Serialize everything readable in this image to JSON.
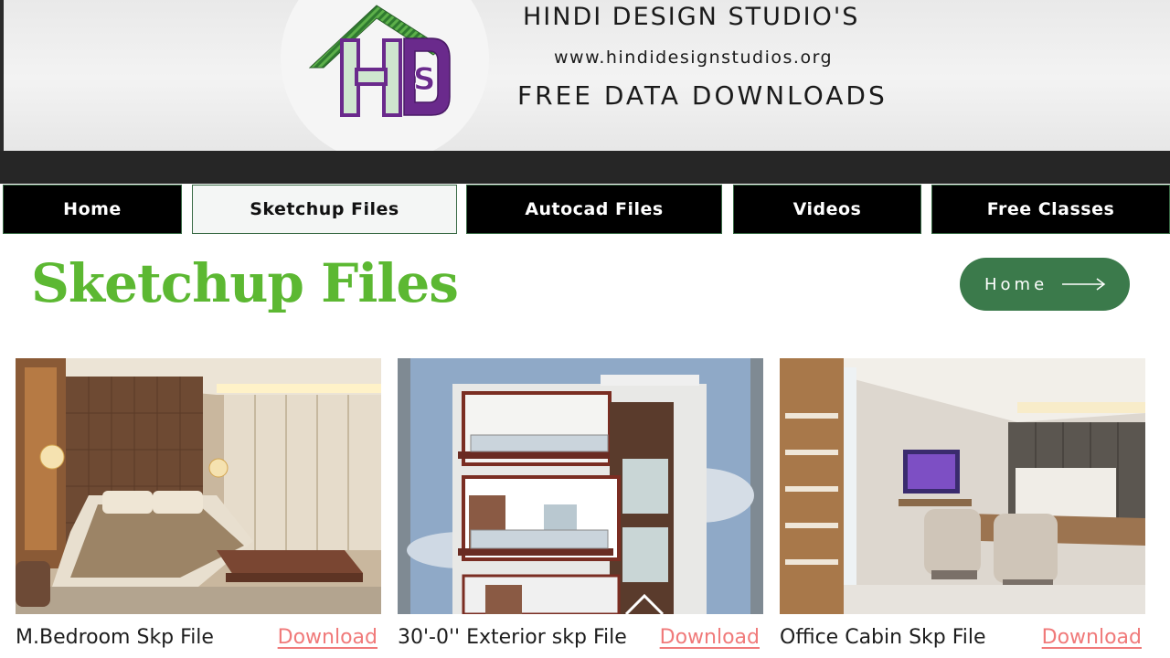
{
  "banner": {
    "title": "HINDI DESIGN STUDIO'S",
    "url": "www.hindidesignstudios.org",
    "subtitle": "FREE DATA DOWNLOADS",
    "logo_text": "HS"
  },
  "nav": {
    "items": [
      {
        "label": "Home"
      },
      {
        "label": "Sketchup Files",
        "active": true
      },
      {
        "label": "Autocad Files"
      },
      {
        "label": "Videos"
      },
      {
        "label": "Free Classes"
      }
    ]
  },
  "page": {
    "title": "Sketchup Files",
    "home_button": "Home"
  },
  "cards": [
    {
      "name": "M.Bedroom Skp File",
      "download": "Download"
    },
    {
      "name": "30'-0'' Exterior skp File",
      "download": "Download"
    },
    {
      "name": "Office Cabin Skp File",
      "download": "Download"
    }
  ],
  "colors": {
    "title_green": "#5cb832",
    "button_green": "#3b7a4b",
    "download_pink": "#f07a7a",
    "nav_black": "#000000",
    "logo_purple": "#6a2a8c",
    "logo_green": "#3f8a3f"
  }
}
